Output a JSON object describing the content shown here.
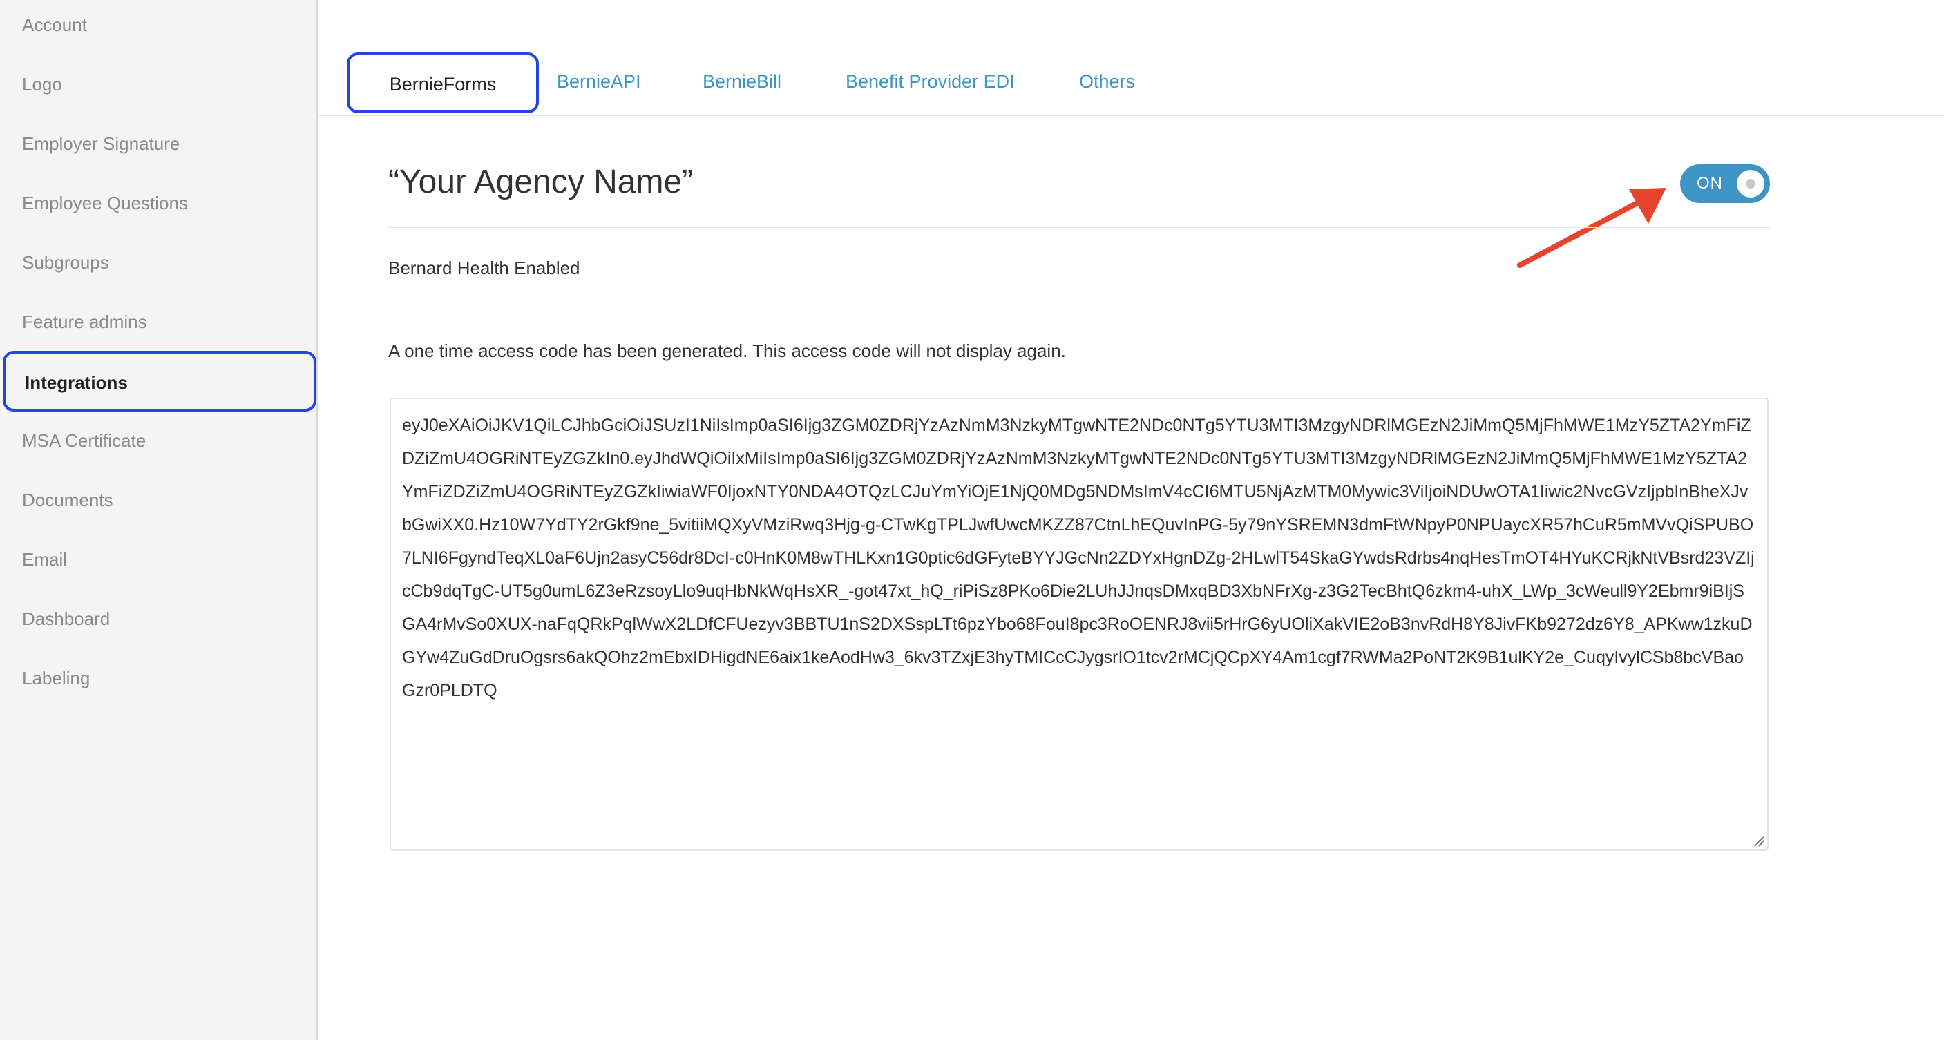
{
  "sidebar": {
    "items": [
      {
        "label": "Account",
        "active": false
      },
      {
        "label": "Logo",
        "active": false
      },
      {
        "label": "Employer Signature",
        "active": false
      },
      {
        "label": "Employee Questions",
        "active": false
      },
      {
        "label": "Subgroups",
        "active": false
      },
      {
        "label": "Feature admins",
        "active": false
      },
      {
        "label": "Integrations",
        "active": true
      },
      {
        "label": "MSA Certificate",
        "active": false
      },
      {
        "label": "Documents",
        "active": false
      },
      {
        "label": "Email",
        "active": false
      },
      {
        "label": "Dashboard",
        "active": false
      },
      {
        "label": "Labeling",
        "active": false
      }
    ]
  },
  "tabs": [
    {
      "label": "BernieForms",
      "active": true
    },
    {
      "label": "BernieAPI",
      "active": false
    },
    {
      "label": "BernieBill",
      "active": false
    },
    {
      "label": "Benefit Provider EDI",
      "active": false
    },
    {
      "label": "Others",
      "active": false
    }
  ],
  "main": {
    "title": "“Your Agency Name”",
    "toggle": {
      "label": "ON",
      "state": "on"
    },
    "status_text": "Bernard Health Enabled",
    "notice_text": "A one time access code has been generated. This access code will not display again.",
    "access_code": "eyJ0eXAiOiJKV1QiLCJhbGciOiJSUzI1NiIsImp0aSI6Ijg3ZGM0ZDRjYzAzNmM3NzkyMTgwNTE2NDc0NTg5YTU3MTI3MzgyNDRlMGEzN2JiMmQ5MjFhMWE1MzY5ZTA2YmFiZDZiZmU4OGRiNTEyZGZkIn0.eyJhdWQiOiIxMiIsImp0aSI6Ijg3ZGM0ZDRjYzAzNmM3NzkyMTgwNTE2NDc0NTg5YTU3MTI3MzgyNDRlMGEzN2JiMmQ5MjFhMWE1MzY5ZTA2YmFiZDZiZmU4OGRiNTEyZGZkIiwiaWF0IjoxNTY0NDA4OTQzLCJuYmYiOjE1NjQ0MDg5NDMsImV4cCI6MTU5NjAzMTM0Mywic3ViIjoiNDUwOTA1Iiwic2NvcGVzIjpbInBheXJvbGwiXX0.Hz10W7YdTY2rGkf9ne_5vitiiMQXyVMziRwq3Hjg-g-CTwKgTPLJwfUwcMKZZ87CtnLhEQuvInPG-5y79nYSREMN3dmFtWNpyP0NPUaycXR57hCuR5mMVvQiSPUBO7LNI6FgyndTeqXL0aF6Ujn2asyC56dr8DcI-c0HnK0M8wTHLKxn1G0ptic6dGFyteBYYJGcNn2ZDYxHgnDZg-2HLwlT54SkaGYwdsRdrbs4nqHesTmOT4HYuKCRjkNtVBsrd23VZIjcCb9dqTgC-UT5g0umL6Z3eRzsoyLlo9uqHbNkWqHsXR_-got47xt_hQ_riPiSz8PKo6Die2LUhJJnqsDMxqBD3XbNFrXg-z3G2TecBhtQ6zkm4-uhX_LWp_3cWeull9Y2Ebmr9iBIjSGA4rMvSo0XUX-naFqQRkPqlWwX2LDfCFUezyv3BBTU1nS2DXSspLTt6pzYbo68FouI8pc3RoOENRJ8vii5rHrG6yUOliXakVIE2oB3nvRdH8Y8JivFKb9272dz6Y8_APKww1zkuDGYw4ZuGdDruOgsrs6akQOhz2mEbxIDHigdNE6aix1keAodHw3_6kv3TZxjE3hyTMICcCJygsrIO1tcv2rMCjQCpXY4Am1cgf7RWMa2PoNT2K9B1ulKY2e_CuqyIvylCSb8bcVBaoGzr0PLDTQ"
  },
  "colors": {
    "accent": "#3e94c4",
    "link": "#3b96c6",
    "focus_outline": "#2346e0",
    "annotation_arrow": "#e8432d"
  }
}
